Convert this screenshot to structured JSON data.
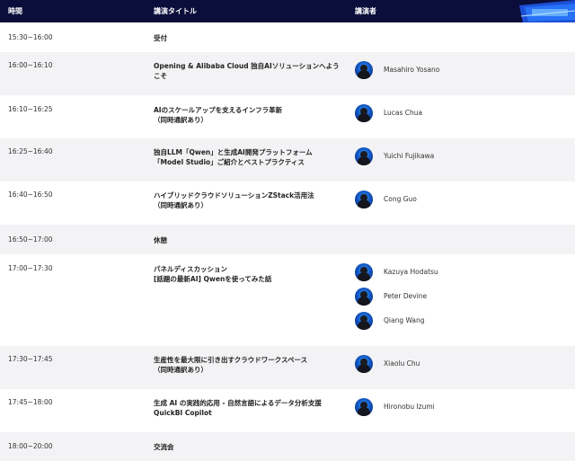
{
  "header": {
    "col_time": "時間",
    "col_title": "講演タイトル",
    "col_speaker": "講演者"
  },
  "rows": [
    {
      "time": "15:30~16:00",
      "title": [
        "受付"
      ],
      "speakers": []
    },
    {
      "time": "16:00~16:10",
      "title": [
        "Opening & Alibaba Cloud 独自AIソリューションへよう",
        "こそ"
      ],
      "speakers": [
        "Masahiro Yosano"
      ]
    },
    {
      "time": "16:10~16:25",
      "title": [
        "AIのスケールアップを支えるインフラ革新",
        "（同時通訳あり）"
      ],
      "speakers": [
        "Lucas Chua"
      ]
    },
    {
      "time": "16:25~16:40",
      "title": [
        "独自LLM「Qwen」と生成AI開発プラットフォーム",
        "「Model Studio」ご紹介とベストプラクティス"
      ],
      "speakers": [
        "Yuichi Fujikawa"
      ]
    },
    {
      "time": "16:40~16:50",
      "title": [
        "ハイブリッドクラウドソリューションZStack活用法",
        "（同時通訳あり）"
      ],
      "speakers": [
        "Cong Guo"
      ]
    },
    {
      "time": "16:50~17:00",
      "title": [
        "休憩"
      ],
      "speakers": []
    },
    {
      "time": "17:00~17:30",
      "title": [
        "パネルディスカッション",
        "[話題の最新AI] Qwenを使ってみた話"
      ],
      "speakers": [
        "Kazuya Hodatsu",
        "Peter Devine",
        "Qiang Wang"
      ]
    },
    {
      "time": "17:30~17:45",
      "title": [
        "生産性を最大限に引き出すクラウドワークスペース",
        "（同時通訳あり）"
      ],
      "speakers": [
        "Xiaolu Chu"
      ]
    },
    {
      "time": "17:45~18:00",
      "title": [
        "生成 AI の実践的応用 - 自然言語によるデータ分析支援",
        "QuickBI Copilot"
      ],
      "speakers": [
        "Hironobu Izumi"
      ]
    },
    {
      "time": "18:00~20:00",
      "title": [
        "交流会"
      ],
      "speakers": []
    }
  ]
}
